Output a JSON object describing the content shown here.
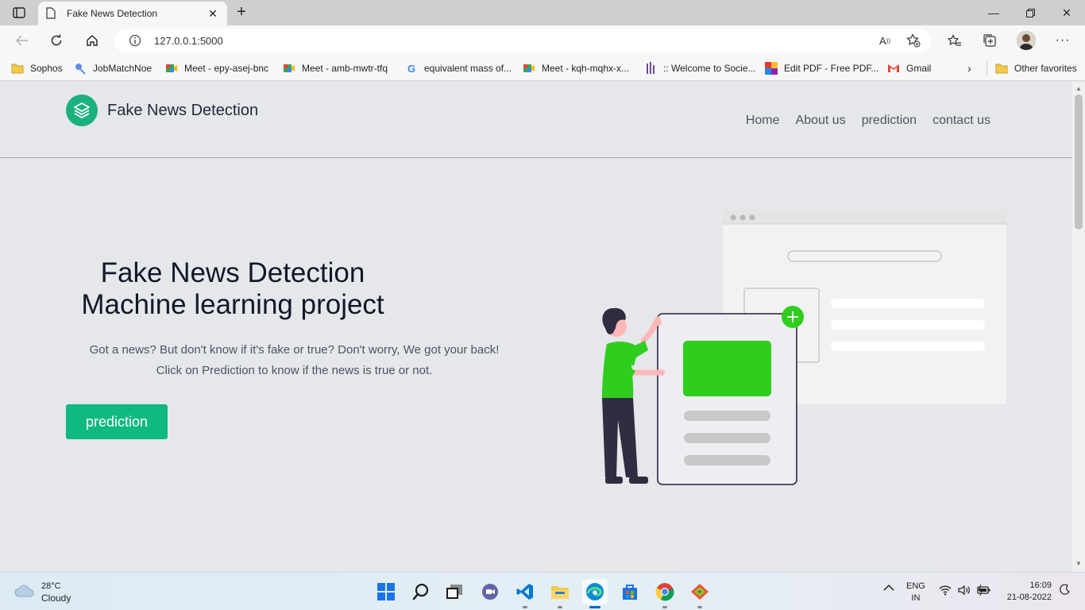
{
  "browser": {
    "tab_title": "Fake News Detection",
    "url": "127.0.0.1:5000"
  },
  "bookmarks": [
    {
      "label": "Sophos",
      "icon": "folder-icon"
    },
    {
      "label": "JobMatchNoe",
      "icon": "jobmatch-icon"
    },
    {
      "label": "Meet - epy-asej-bnc",
      "icon": "meet-icon"
    },
    {
      "label": "Meet - amb-mwtr-tfq",
      "icon": "meet-icon"
    },
    {
      "label": "equivalent mass of...",
      "icon": "google-icon"
    },
    {
      "label": "Meet - kqh-mqhx-x...",
      "icon": "meet-icon"
    },
    {
      "label": ":: Welcome to Socie...",
      "icon": "society-icon"
    },
    {
      "label": "Edit PDF - Free PDF...",
      "icon": "pdf-icon"
    },
    {
      "label": "Gmail",
      "icon": "gmail-icon"
    }
  ],
  "other_favorites": "Other favorites",
  "site": {
    "brand": "Fake News Detection",
    "nav": [
      "Home",
      "About us",
      "prediction",
      "contact us"
    ],
    "hero_title_1": "Fake News Detection",
    "hero_title_2": "Machine learning project",
    "hero_text_1": "Got a news? But don't know if it's fake or true? Don't worry, We got your back!",
    "hero_text_2": "Click on Prediction to know if the news is true or not.",
    "cta_label": "prediction"
  },
  "taskbar": {
    "temp": "28°C",
    "weather": "Cloudy",
    "lang": "ENG",
    "region": "IN",
    "time": "16:09",
    "date": "21-08-2022"
  },
  "colors": {
    "accent": "#10b981",
    "illustration_green": "#2fce1e",
    "page_bg": "#e5e7eb"
  }
}
